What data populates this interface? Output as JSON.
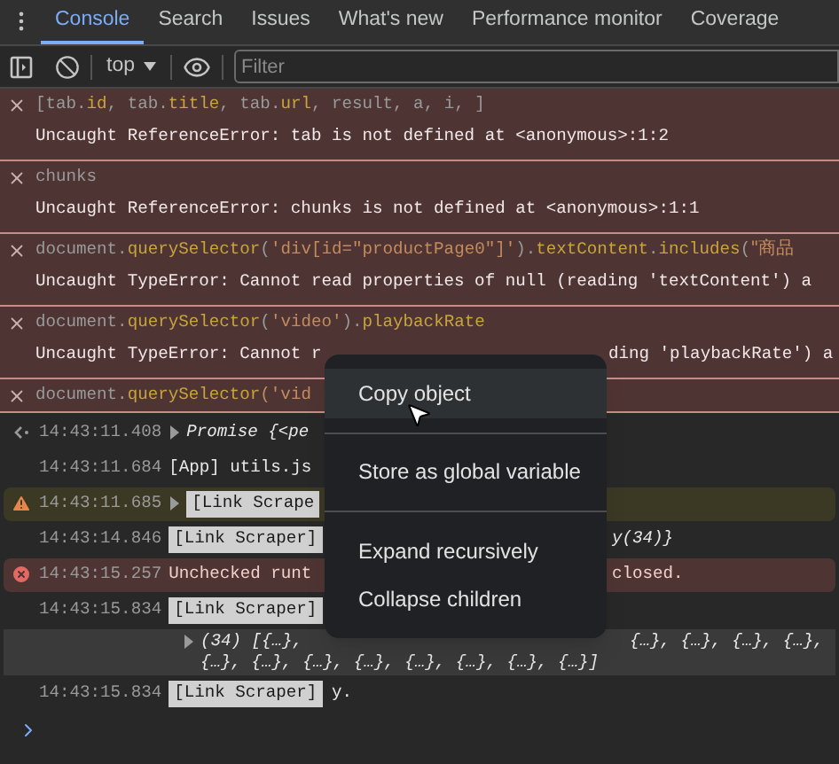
{
  "tabs": [
    {
      "label": "Console",
      "selected": true
    },
    {
      "label": "Search",
      "selected": false
    },
    {
      "label": "Issues",
      "selected": false
    },
    {
      "label": "What's new",
      "selected": false
    },
    {
      "label": "Performance monitor",
      "selected": false
    },
    {
      "label": "Coverage",
      "selected": false
    }
  ],
  "toolbar": {
    "context": "top",
    "filter_placeholder": "Filter"
  },
  "errors": [
    {
      "code": [
        {
          "kind": "plain",
          "text": "[tab."
        },
        {
          "kind": "prop",
          "text": "id"
        },
        {
          "kind": "plain",
          "text": ", tab."
        },
        {
          "kind": "prop",
          "text": "title"
        },
        {
          "kind": "plain",
          "text": ", tab."
        },
        {
          "kind": "prop",
          "text": "url"
        },
        {
          "kind": "plain",
          "text": ", result, a, i, ]"
        }
      ],
      "message": "Uncaught ReferenceError: tab is not defined at <anonymous>:1:2"
    },
    {
      "code": [
        {
          "kind": "plain",
          "text": "chunks"
        }
      ],
      "message": "Uncaught ReferenceError: chunks is not defined at <anonymous>:1:1"
    },
    {
      "code": [
        {
          "kind": "plain",
          "text": "document."
        },
        {
          "kind": "prop",
          "text": "querySelector"
        },
        {
          "kind": "plain",
          "text": "("
        },
        {
          "kind": "string",
          "text": "'div[id=\"productPage0\"]'"
        },
        {
          "kind": "plain",
          "text": ")."
        },
        {
          "kind": "prop",
          "text": "textContent"
        },
        {
          "kind": "plain",
          "text": "."
        },
        {
          "kind": "prop",
          "text": "includes"
        },
        {
          "kind": "plain",
          "text": "("
        },
        {
          "kind": "cjk-string",
          "text": "\"商品"
        }
      ],
      "message": "Uncaught TypeError: Cannot read properties of null (reading 'textContent') a"
    },
    {
      "code": [
        {
          "kind": "plain",
          "text": "document."
        },
        {
          "kind": "prop",
          "text": "querySelector"
        },
        {
          "kind": "plain",
          "text": "("
        },
        {
          "kind": "string",
          "text": "'video'"
        },
        {
          "kind": "plain",
          "text": ")."
        },
        {
          "kind": "prop",
          "text": "playbackRate"
        }
      ],
      "message": "Uncaught TypeError: Cannot r",
      "message_after_menu": "ding 'playbackRate') a"
    },
    {
      "code": [
        {
          "kind": "plain",
          "text": "document."
        },
        {
          "kind": "prop",
          "text": "querySelector"
        },
        {
          "kind": "string",
          "text": "('vid"
        }
      ]
    }
  ],
  "logs": [
    {
      "kind": "result",
      "time": "14:43:11.408",
      "expandable": true,
      "text": "Promise {<pe"
    },
    {
      "kind": "log",
      "time": "14:43:11.684",
      "expandable": false,
      "text": "[App] utils.js"
    },
    {
      "kind": "warning",
      "time": "14:43:11.685",
      "expandable": true,
      "badge": "[Link Scrape"
    },
    {
      "kind": "log",
      "time": "14:43:14.846",
      "expandable": false,
      "badge": "[Link Scraper]",
      "after_menu": "y(34)}"
    },
    {
      "kind": "error",
      "time": "14:43:15.257",
      "expandable": false,
      "text": "Unchecked runt",
      "after_menu": "closed."
    },
    {
      "kind": "log",
      "time": "14:43:15.834",
      "expandable": false,
      "badge": "[Link Scraper]",
      "object": {
        "left": "(34) [{…},",
        "right": "{…}, {…}, {…}, {…},",
        "second_line": "{…}, {…}, {…}, {…}, {…}, {…}, {…}, {…}]"
      }
    },
    {
      "kind": "log",
      "time": "14:43:15.834",
      "expandable": false,
      "badge": "[Link Scraper]",
      "text": "y."
    }
  ],
  "context_menu": [
    {
      "label": "Copy object",
      "selected": true,
      "divider_after": true
    },
    {
      "label": "Store as global variable",
      "selected": false,
      "divider_after": true
    },
    {
      "label": "Expand recursively",
      "selected": false,
      "divider_after": false
    },
    {
      "label": "Collapse children",
      "selected": false,
      "divider_after": false
    }
  ]
}
